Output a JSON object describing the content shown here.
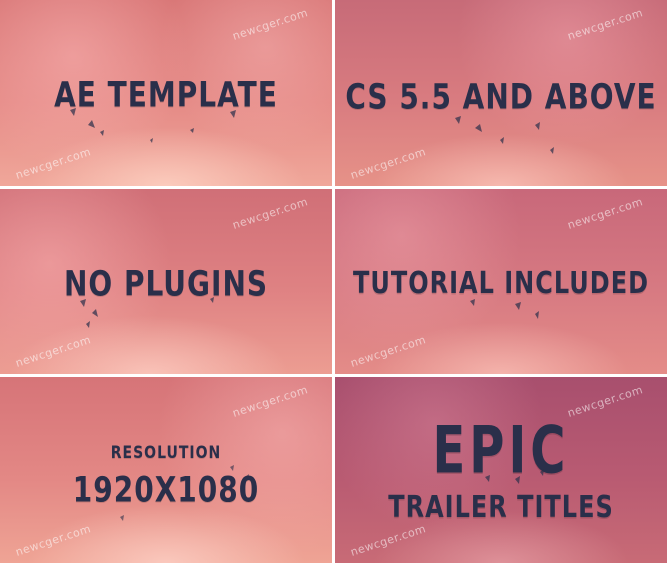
{
  "panels": [
    {
      "headline": "AE TEMPLATE",
      "watermark": "newcger.com"
    },
    {
      "headline": "CS 5.5 AND ABOVE",
      "watermark": "newcger.com"
    },
    {
      "headline": "NO PLUGINS",
      "watermark": "newcger.com"
    },
    {
      "headline": "TUTORIAL INCLUDED",
      "watermark": "newcger.com"
    },
    {
      "headline_top": "RESOLUTION",
      "headline": "1920x1080",
      "watermark": "newcger.com"
    },
    {
      "headline": "EPIC",
      "headline_bottom": "TRAILER TITLES",
      "watermark": "newcger.com"
    }
  ],
  "colors": {
    "text": "#2a2f4a",
    "background_pink": "#e0817f",
    "background_mauve": "#b95b72"
  },
  "watermark_bottom_left": "newcger.com"
}
